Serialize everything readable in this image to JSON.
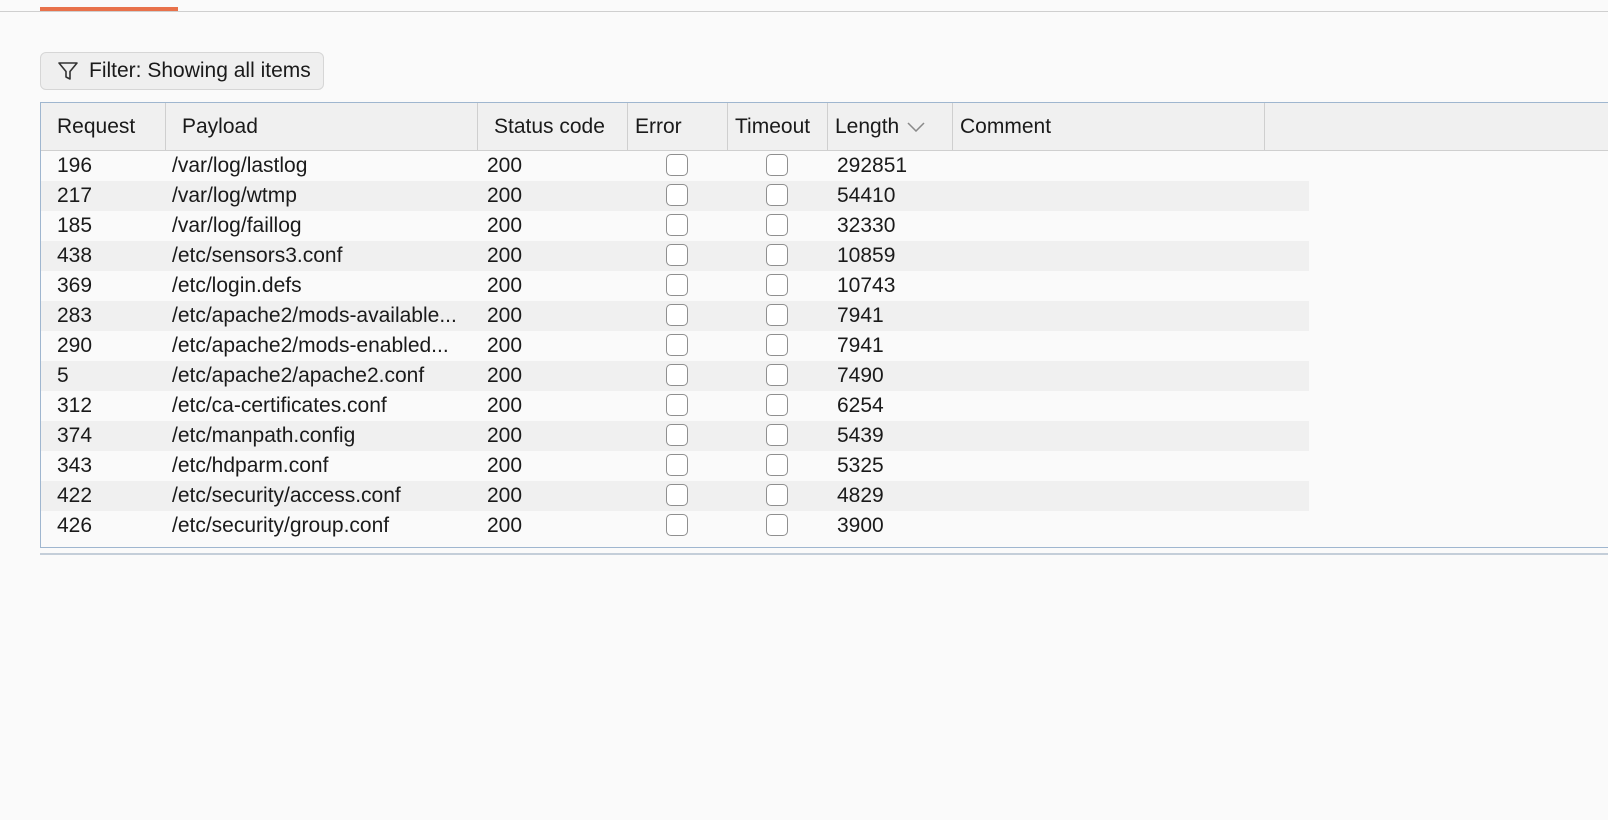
{
  "filter": {
    "label": "Filter: Showing all items",
    "icon": "filter-funnel-icon"
  },
  "table": {
    "columns": [
      "Request",
      "Payload",
      "Status code",
      "Error",
      "Timeout",
      "Length",
      "Comment"
    ],
    "sorted_by": "Length",
    "sort_direction": "descending",
    "rows": [
      {
        "request": "196",
        "payload": "/var/log/lastlog",
        "status": "200",
        "error": false,
        "timeout": false,
        "length": "292851",
        "comment": ""
      },
      {
        "request": "217",
        "payload": "/var/log/wtmp",
        "status": "200",
        "error": false,
        "timeout": false,
        "length": "54410",
        "comment": ""
      },
      {
        "request": "185",
        "payload": "/var/log/faillog",
        "status": "200",
        "error": false,
        "timeout": false,
        "length": "32330",
        "comment": ""
      },
      {
        "request": "438",
        "payload": "/etc/sensors3.conf",
        "status": "200",
        "error": false,
        "timeout": false,
        "length": "10859",
        "comment": ""
      },
      {
        "request": "369",
        "payload": "/etc/login.defs",
        "status": "200",
        "error": false,
        "timeout": false,
        "length": "10743",
        "comment": ""
      },
      {
        "request": "283",
        "payload": "/etc/apache2/mods-available...",
        "status": "200",
        "error": false,
        "timeout": false,
        "length": "7941",
        "comment": ""
      },
      {
        "request": "290",
        "payload": "/etc/apache2/mods-enabled...",
        "status": "200",
        "error": false,
        "timeout": false,
        "length": "7941",
        "comment": ""
      },
      {
        "request": "5",
        "payload": "/etc/apache2/apache2.conf",
        "status": "200",
        "error": false,
        "timeout": false,
        "length": "7490",
        "comment": ""
      },
      {
        "request": "312",
        "payload": "/etc/ca-certificates.conf",
        "status": "200",
        "error": false,
        "timeout": false,
        "length": "6254",
        "comment": ""
      },
      {
        "request": "374",
        "payload": "/etc/manpath.config",
        "status": "200",
        "error": false,
        "timeout": false,
        "length": "5439",
        "comment": ""
      },
      {
        "request": "343",
        "payload": "/etc/hdparm.conf",
        "status": "200",
        "error": false,
        "timeout": false,
        "length": "5325",
        "comment": ""
      },
      {
        "request": "422",
        "payload": "/etc/security/access.conf",
        "status": "200",
        "error": false,
        "timeout": false,
        "length": "4829",
        "comment": ""
      },
      {
        "request": "426",
        "payload": "/etc/security/group.conf",
        "status": "200",
        "error": false,
        "timeout": false,
        "length": "3900",
        "comment": ""
      }
    ]
  },
  "colors": {
    "accent_tab": "#e8714a",
    "table_border": "#9fb6cf",
    "header_bg": "#f0f0f0",
    "row_alt_bg": "#f0f0f0"
  }
}
